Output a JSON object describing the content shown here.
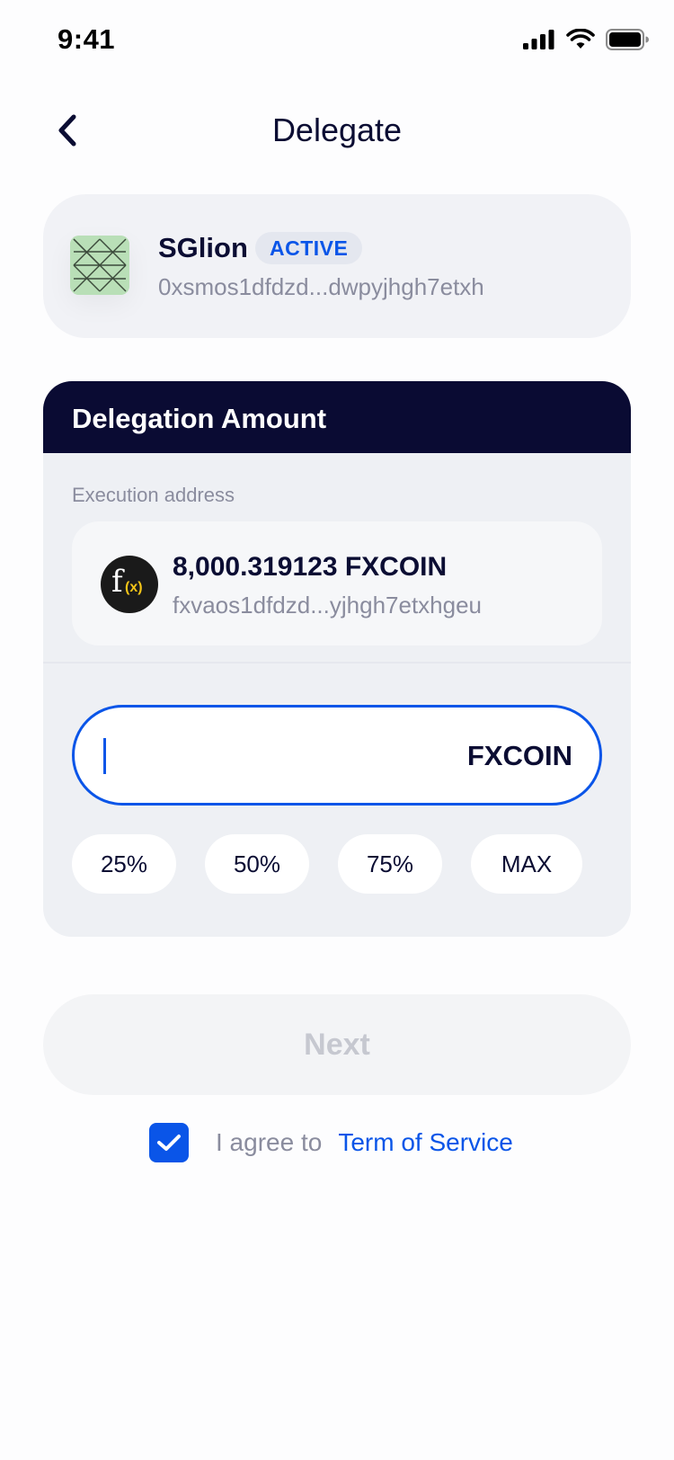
{
  "status_bar": {
    "time": "9:41"
  },
  "header": {
    "title": "Delegate"
  },
  "validator": {
    "name": "SGlion",
    "status": "ACTIVE",
    "address": "0xsmos1dfdzd...dwpyjhgh7etxh"
  },
  "delegation": {
    "title": "Delegation Amount",
    "execution_label": "Execution address",
    "balance": "8,000.319123 FXCOIN",
    "account_address": "fxvaos1dfdzd...yjhgh7etxhgeu",
    "input_unit": "FXCOIN",
    "input_value": "",
    "percent_options": [
      "25%",
      "50%",
      "75%",
      "MAX"
    ]
  },
  "actions": {
    "next_label": "Next",
    "agree_text": "I agree to",
    "tos_link": "Term of Service",
    "agreed": true
  },
  "colors": {
    "accent": "#0a55e8",
    "header_dark": "#0a0b33",
    "text_primary": "#0b0d33",
    "text_secondary": "#8a8c9e",
    "coin_yellow": "#f5c518"
  }
}
